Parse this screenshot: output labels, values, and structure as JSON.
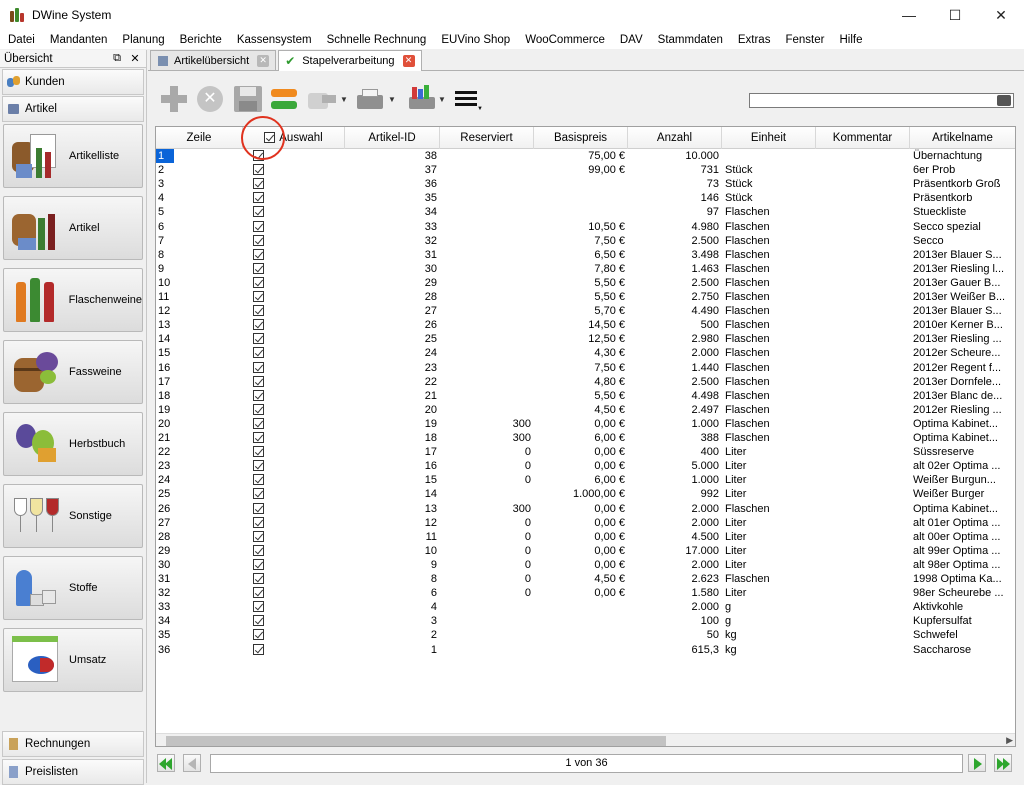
{
  "window": {
    "title": "DWine System"
  },
  "menu": [
    "Datei",
    "Mandanten",
    "Planung",
    "Berichte",
    "Kassensystem",
    "Schnelle Rechnung",
    "EUVino Shop",
    "WooCommerce",
    "DAV",
    "Stammdaten",
    "Extras",
    "Fenster",
    "Hilfe"
  ],
  "sidebar": {
    "header": "Übersicht",
    "top_bars": [
      "Kunden",
      "Artikel"
    ],
    "buttons": [
      "Artikelliste",
      "Artikel",
      "Flaschenweine",
      "Fassweine",
      "Herbstbuch",
      "Sonstige",
      "Stoffe",
      "Umsatz"
    ],
    "bottom_bars": [
      "Rechnungen",
      "Preislisten"
    ]
  },
  "tabs": [
    {
      "label": "Artikelübersicht",
      "active": false
    },
    {
      "label": "Stapelverarbeitung",
      "active": true
    }
  ],
  "toolbar_icons": [
    "add-icon",
    "cancel-icon",
    "save-icon",
    "refresh-icon",
    "export-icon",
    "print-icon",
    "print-color-icon",
    "menu-icon"
  ],
  "columns": [
    "Zeile",
    "Auswahl",
    "Artikel-ID",
    "Reserviert",
    "Basispreis",
    "Anzahl",
    "Einheit",
    "Kommentar",
    "Artikelname"
  ],
  "rows": [
    [
      "1",
      "38",
      "",
      "75,00 €",
      "10.000",
      "",
      "Übernachtung"
    ],
    [
      "2",
      "37",
      "",
      "99,00 €",
      "731",
      "Stück",
      "6er Prob"
    ],
    [
      "3",
      "36",
      "",
      "",
      "73",
      "Stück",
      "Präsentkorb Groß"
    ],
    [
      "4",
      "35",
      "",
      "",
      "146",
      "Stück",
      "Präsentkorb"
    ],
    [
      "5",
      "34",
      "",
      "",
      "97",
      "Flaschen",
      "Stueckliste"
    ],
    [
      "6",
      "33",
      "",
      "10,50 €",
      "4.980",
      "Flaschen",
      "Secco spezial"
    ],
    [
      "7",
      "32",
      "",
      "7,50 €",
      "2.500",
      "Flaschen",
      "Secco"
    ],
    [
      "8",
      "31",
      "",
      "6,50 €",
      "3.498",
      "Flaschen",
      "2013er Blauer S..."
    ],
    [
      "9",
      "30",
      "",
      "7,80 €",
      "1.463",
      "Flaschen",
      "2013er Riesling l..."
    ],
    [
      "10",
      "29",
      "",
      "5,50 €",
      "2.500",
      "Flaschen",
      "2013er Gauer B..."
    ],
    [
      "11",
      "28",
      "",
      "5,50 €",
      "2.750",
      "Flaschen",
      "2013er Weißer B..."
    ],
    [
      "12",
      "27",
      "",
      "5,70 €",
      "4.490",
      "Flaschen",
      "2013er Blauer S..."
    ],
    [
      "13",
      "26",
      "",
      "14,50 €",
      "500",
      "Flaschen",
      "2010er Kerner B..."
    ],
    [
      "14",
      "25",
      "",
      "12,50 €",
      "2.980",
      "Flaschen",
      "2013er Riesling ..."
    ],
    [
      "15",
      "24",
      "",
      "4,30 €",
      "2.000",
      "Flaschen",
      "2012er Scheure..."
    ],
    [
      "16",
      "23",
      "",
      "7,50 €",
      "1.440",
      "Flaschen",
      "2012er Regent f..."
    ],
    [
      "17",
      "22",
      "",
      "4,80 €",
      "2.500",
      "Flaschen",
      "2013er Dornfele..."
    ],
    [
      "18",
      "21",
      "",
      "5,50 €",
      "4.498",
      "Flaschen",
      "2013er Blanc de..."
    ],
    [
      "19",
      "20",
      "",
      "4,50 €",
      "2.497",
      "Flaschen",
      "2012er Riesling ..."
    ],
    [
      "20",
      "19",
      "300",
      "0,00 €",
      "1.000",
      "Flaschen",
      "Optima Kabinet..."
    ],
    [
      "21",
      "18",
      "300",
      "6,00 €",
      "388",
      "Flaschen",
      "Optima Kabinet..."
    ],
    [
      "22",
      "17",
      "0",
      "0,00 €",
      "400",
      "Liter",
      "Süssreserve"
    ],
    [
      "23",
      "16",
      "0",
      "0,00 €",
      "5.000",
      "Liter",
      "alt 02er Optima ..."
    ],
    [
      "24",
      "15",
      "0",
      "6,00 €",
      "1.000",
      "Liter",
      "Weißer Burgun..."
    ],
    [
      "25",
      "14",
      "",
      "1.000,00 €",
      "992",
      "Liter",
      "Weißer Burger"
    ],
    [
      "26",
      "13",
      "300",
      "0,00 €",
      "2.000",
      "Flaschen",
      "Optima Kabinet..."
    ],
    [
      "27",
      "12",
      "0",
      "0,00 €",
      "2.000",
      "Liter",
      "alt 01er Optima ..."
    ],
    [
      "28",
      "11",
      "0",
      "0,00 €",
      "4.500",
      "Liter",
      "alt 00er Optima ..."
    ],
    [
      "29",
      "10",
      "0",
      "0,00 €",
      "17.000",
      "Liter",
      "alt 99er Optima ..."
    ],
    [
      "30",
      "9",
      "0",
      "0,00 €",
      "2.000",
      "Liter",
      "alt 98er Optima ..."
    ],
    [
      "31",
      "8",
      "0",
      "4,50 €",
      "2.623",
      "Flaschen",
      "1998 Optima Ka..."
    ],
    [
      "32",
      "6",
      "0",
      "0,00 €",
      "1.580",
      "Liter",
      "98er Scheurebe ..."
    ],
    [
      "33",
      "4",
      "",
      "",
      "2.000",
      "g",
      "Aktivkohle"
    ],
    [
      "34",
      "3",
      "",
      "",
      "100",
      "g",
      "Kupfersulfat"
    ],
    [
      "35",
      "2",
      "",
      "",
      "50",
      "kg",
      "Schwefel"
    ],
    [
      "36",
      "1",
      "",
      "",
      "615,3",
      "kg",
      "Saccharose"
    ]
  ],
  "pager": {
    "text": "1 von 36"
  },
  "colors": {
    "selection": "#0a64d8",
    "highlight_circle": "#e0321e",
    "nav_green": "#2ea62e"
  }
}
